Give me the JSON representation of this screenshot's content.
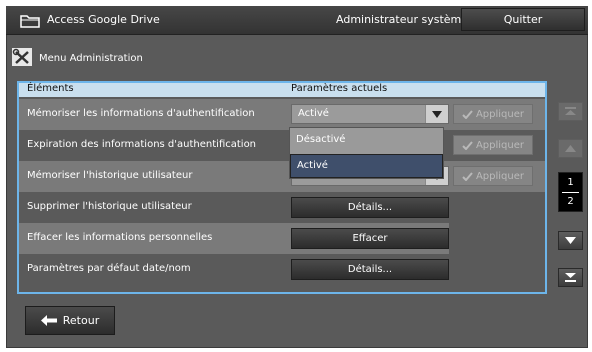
{
  "topbar": {
    "title": "Access Google Drive",
    "user": "Administrateur système",
    "quit_label": "Quitter"
  },
  "menu": {
    "title": "Menu Administration"
  },
  "table": {
    "col_items": "Éléments",
    "col_current": "Paramètres actuels",
    "rows": [
      {
        "label": "Mémoriser les informations d'authentification",
        "value": "Activé",
        "apply": "Appliquer"
      },
      {
        "label": "Expiration des informations d'authentification",
        "apply": "Appliquer"
      },
      {
        "label": "Mémoriser l'historique utilisateur",
        "value": "Activé",
        "apply": "Appliquer"
      },
      {
        "label": "Supprimer l'historique utilisateur",
        "button": "Détails..."
      },
      {
        "label": "Effacer les informations personnelles",
        "button": "Effacer"
      },
      {
        "label": "Paramètres par défaut date/nom",
        "button": "Détails..."
      }
    ]
  },
  "dropdown": {
    "options": [
      "Désactivé",
      "Activé"
    ],
    "selected": "Activé"
  },
  "pagination": {
    "current": "1",
    "total": "2"
  },
  "footer": {
    "back_label": "Retour"
  },
  "colors": {
    "accent": "#6db5ea",
    "selected_option": "#3f4f6b"
  }
}
